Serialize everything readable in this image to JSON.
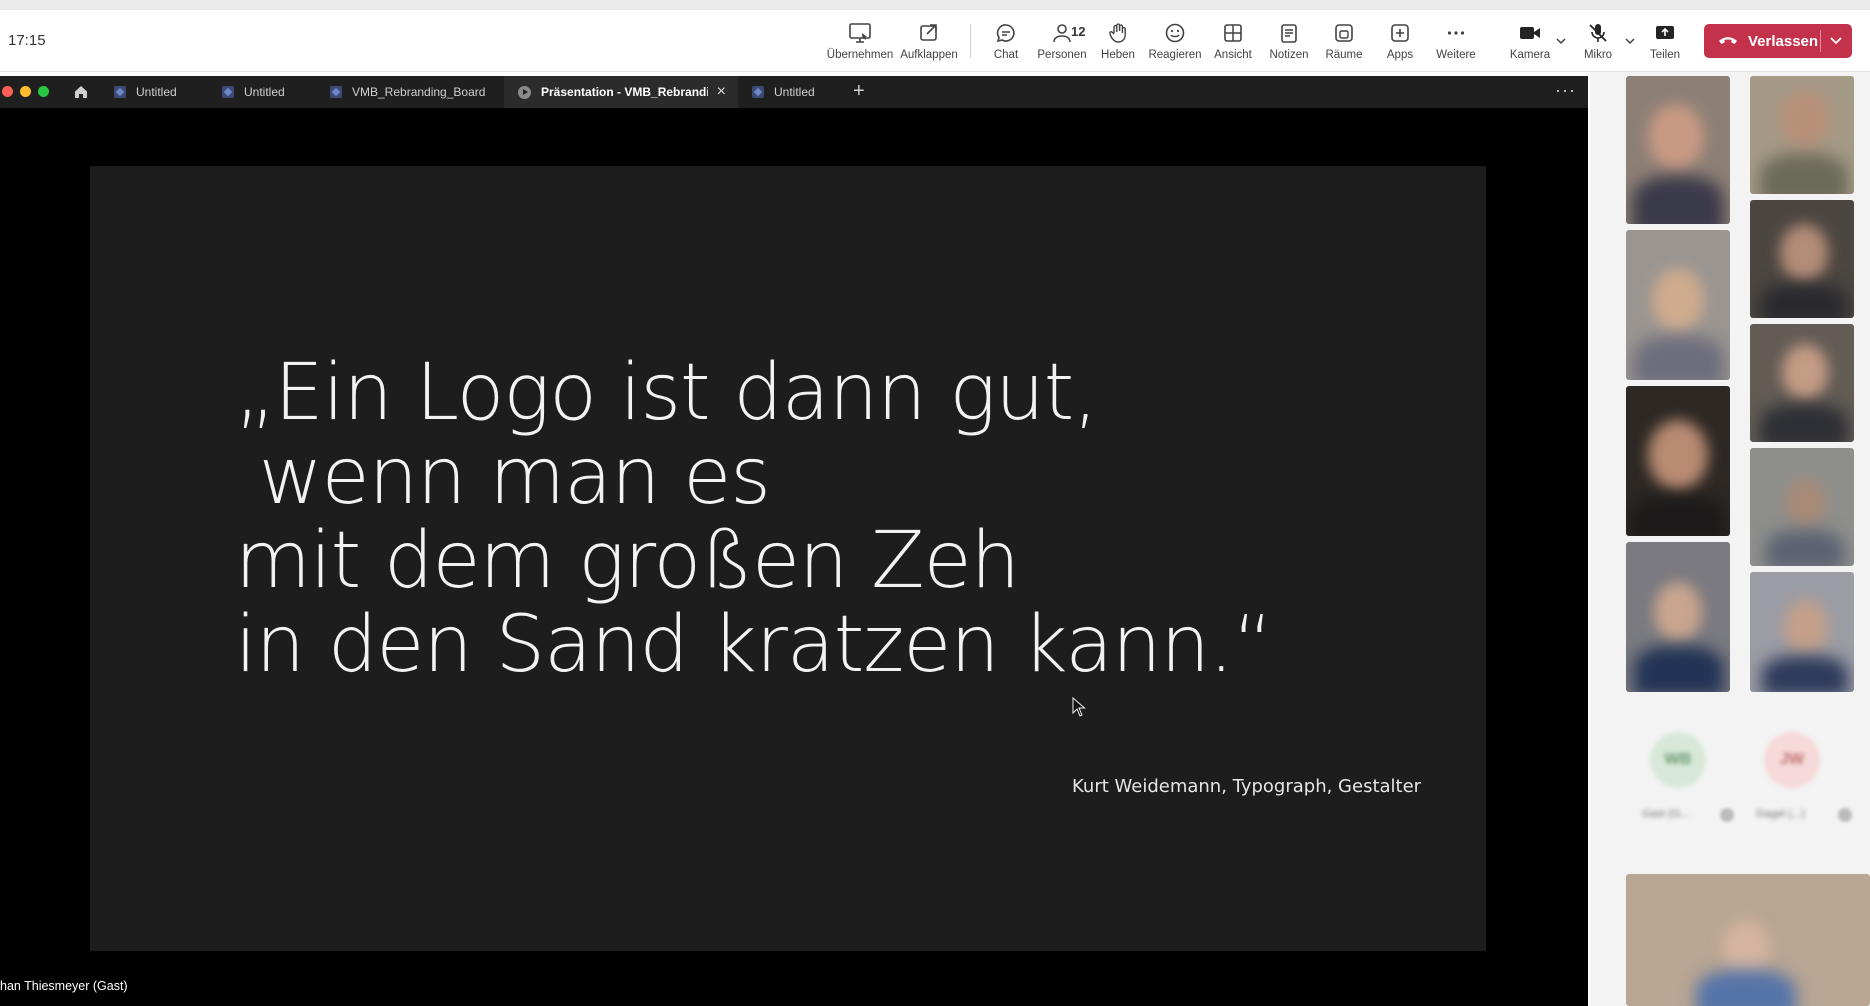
{
  "clock": "17:15",
  "toolbar": {
    "share_take": "Übernehmen",
    "popout": "Aufklappen",
    "chat": "Chat",
    "people": "Personen",
    "people_count": "12",
    "raise": "Heben",
    "react": "Reagieren",
    "view": "Ansicht",
    "notes": "Notizen",
    "rooms": "Räume",
    "apps": "Apps",
    "more": "Weitere",
    "camera": "Kamera",
    "mic": "Mikro",
    "share": "Teilen",
    "leave": "Verlassen",
    "leave_color": "#c4314b"
  },
  "tabs": [
    {
      "label": "Untitled",
      "active": false
    },
    {
      "label": "Untitled",
      "active": false
    },
    {
      "label": "VMB_Rebranding_Board",
      "active": false
    },
    {
      "label": "Präsentation - VMB_Rebranding_Bo",
      "active": true
    },
    {
      "label": "Untitled",
      "active": false
    }
  ],
  "slide": {
    "quote_lines": [
      "„Ein Logo ist dann gut,",
      " wenn man es",
      "mit dem großen Zeh",
      "in den Sand kratzen kann.“"
    ],
    "author": "Kurt Weidemann, Typograph, Gestalter"
  },
  "presenter_name": "han Thiesmeyer (Gast)",
  "participants_panel": {
    "avatars": [
      {
        "initials": "WB",
        "name": "Gast (G...",
        "color": "#d7e8d9",
        "text_color": "#6a9a70"
      },
      {
        "initials": "JW",
        "name": "Gagel (...)",
        "color": "#f6d9d9",
        "text_color": "#c07070"
      }
    ]
  }
}
